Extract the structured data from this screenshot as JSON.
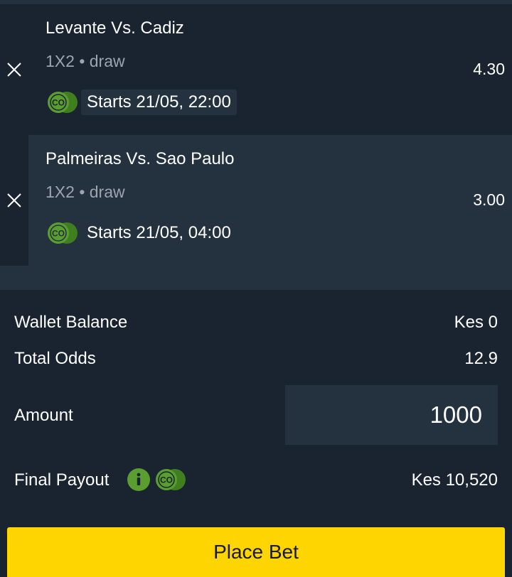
{
  "bets": [
    {
      "match": "Levante Vs. Cadiz",
      "market": "1X2 • draw",
      "starts": "Starts 21/05, 22:00",
      "odds": "4.30",
      "badge": "CO"
    },
    {
      "match": "Palmeiras Vs. Sao Paulo",
      "market": "1X2 • draw",
      "starts": "Starts 21/05, 04:00",
      "odds": "3.00",
      "badge": "CO"
    }
  ],
  "summary": {
    "wallet_label": "Wallet Balance",
    "wallet_value": "Kes 0",
    "odds_label": "Total Odds",
    "odds_value": "12.9",
    "amount_label": "Amount",
    "amount_value": "1000",
    "payout_label": "Final Payout",
    "payout_value": "Kes 10,520",
    "payout_badge": "CO"
  },
  "place_bet_label": "Place Bet",
  "icons": {
    "remove": "close-icon",
    "info": "info-icon",
    "badge": "co-badge-icon"
  },
  "colors": {
    "background": "#1a2430",
    "panel": "#243240",
    "accent_green": "#5a9e2f",
    "button_yellow": "#ffd500",
    "muted_text": "#9aa5b1"
  }
}
